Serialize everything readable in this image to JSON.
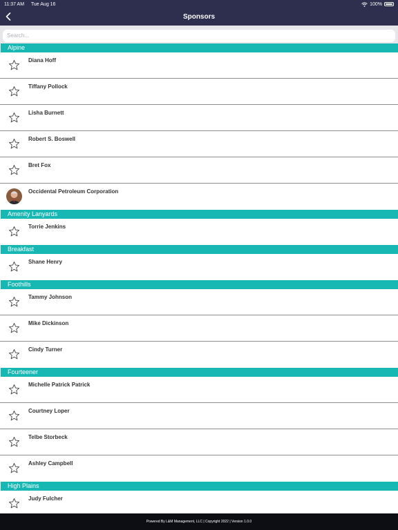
{
  "status": {
    "time": "11:37 AM",
    "date": "Tue Aug 16",
    "battery": "100%"
  },
  "nav": {
    "title": "Sponsors"
  },
  "search": {
    "placeholder": "Search..."
  },
  "sections": [
    {
      "header": "Alpine",
      "items": [
        {
          "name": "Diana Hoff",
          "icon": "star"
        },
        {
          "name": "Tiffany Pollock",
          "icon": "star"
        },
        {
          "name": "Lisha Burnett",
          "icon": "star"
        },
        {
          "name": "Robert S. Boswell",
          "icon": "star"
        },
        {
          "name": "Bret Fox",
          "icon": "star"
        },
        {
          "name": "Occidental Petroleum Corporation",
          "icon": "avatar"
        }
      ]
    },
    {
      "header": "Amenity Lanyards",
      "items": [
        {
          "name": "Torrie Jenkins",
          "icon": "star"
        }
      ]
    },
    {
      "header": "Breakfast",
      "items": [
        {
          "name": "Shane Henry",
          "icon": "star"
        }
      ]
    },
    {
      "header": "Foothills",
      "items": [
        {
          "name": "Tammy Johnson",
          "icon": "star"
        },
        {
          "name": "Mike Dickinson",
          "icon": "star"
        },
        {
          "name": "Cindy Turner",
          "icon": "star"
        }
      ]
    },
    {
      "header": "Fourteener",
      "items": [
        {
          "name": "Michelle Patrick Patrick",
          "icon": "star"
        },
        {
          "name": "Courtney Loper",
          "icon": "star"
        },
        {
          "name": "Telbe Storbeck",
          "icon": "star"
        },
        {
          "name": "Ashley Campbell",
          "icon": "star"
        }
      ]
    },
    {
      "header": "High Plains",
      "items": [
        {
          "name": "Judy Fulcher",
          "icon": "star"
        }
      ]
    }
  ],
  "footer": {
    "text": "Powered By L&M Management, LLC | Copyright 2022 | Version 1.0.0"
  },
  "colors": {
    "nav": "#2e2e4e",
    "section": "#17b8b4",
    "footer": "#0d0d14"
  }
}
